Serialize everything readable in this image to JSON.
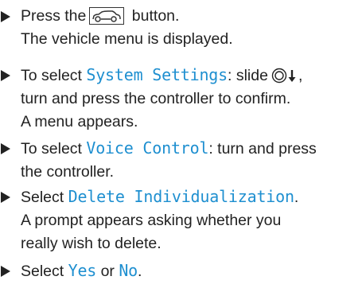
{
  "steps": [
    {
      "lines": [
        {
          "before": "Press the",
          "icon": "vehicle-button-icon",
          "after": "button."
        },
        {
          "text": "The vehicle menu is displayed."
        }
      ]
    },
    {
      "lines": [
        {
          "before": "To select ",
          "highlight": "System Settings",
          "after": ": slide",
          "icon": "controller-slide-down-icon",
          "after2": ","
        },
        {
          "text": "turn and press the controller to confirm."
        },
        {
          "text": "A menu appears."
        }
      ]
    },
    {
      "lines": [
        {
          "before": "To select ",
          "highlight": "Voice Control",
          "after": ": turn and press"
        },
        {
          "text": "the controller."
        }
      ]
    },
    {
      "lines": [
        {
          "before": "Select ",
          "highlight": "Delete Individualization",
          "after": "."
        },
        {
          "text": "A prompt appears asking whether you"
        },
        {
          "text": "really wish to delete."
        }
      ]
    },
    {
      "lines": [
        {
          "before": "Select ",
          "highlight": "Yes",
          "middle": " or ",
          "highlight2": "No",
          "after": "."
        }
      ]
    }
  ],
  "colors": {
    "text": "#222222",
    "highlight": "#1e8fd0"
  }
}
